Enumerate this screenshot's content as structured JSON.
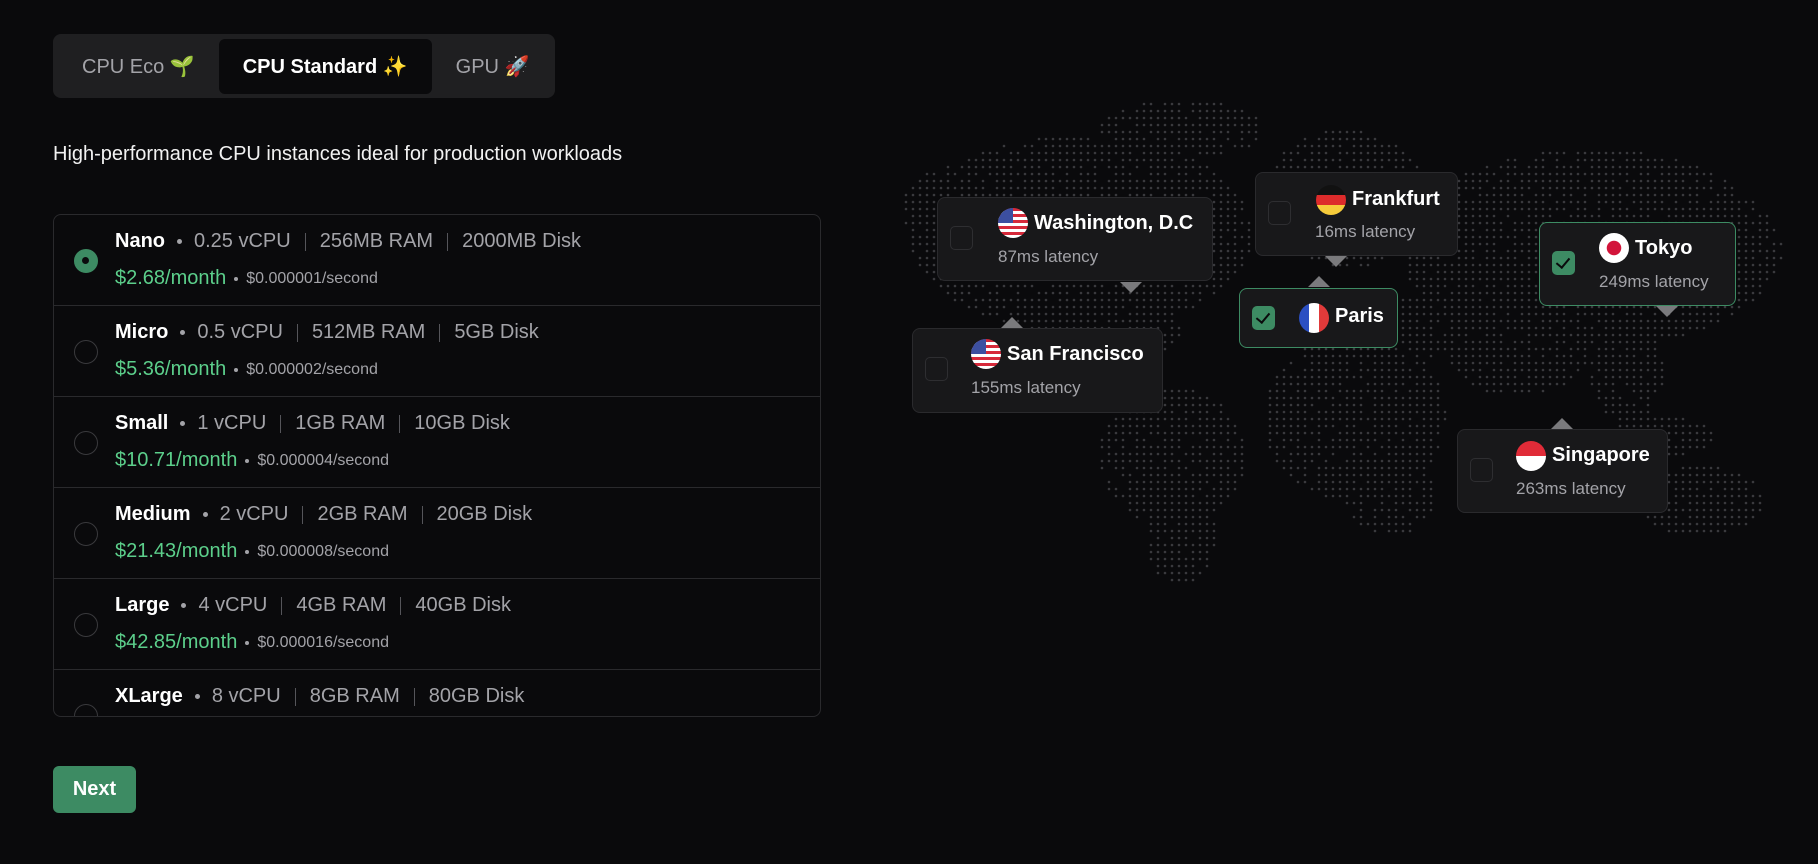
{
  "tabs": [
    {
      "label": "CPU Eco 🌱",
      "active": false
    },
    {
      "label": "CPU Standard ✨",
      "active": true
    },
    {
      "label": "GPU 🚀",
      "active": false
    }
  ],
  "description": "High-performance CPU instances ideal for production workloads",
  "plans": [
    {
      "name": "Nano",
      "cpu": "0.25 vCPU",
      "ram": "256MB RAM",
      "disk": "2000MB Disk",
      "price": "$2.68/month",
      "per_second": "$0.000001/second",
      "selected": true
    },
    {
      "name": "Micro",
      "cpu": "0.5 vCPU",
      "ram": "512MB RAM",
      "disk": "5GB Disk",
      "price": "$5.36/month",
      "per_second": "$0.000002/second",
      "selected": false
    },
    {
      "name": "Small",
      "cpu": "1 vCPU",
      "ram": "1GB RAM",
      "disk": "10GB Disk",
      "price": "$10.71/month",
      "per_second": "$0.000004/second",
      "selected": false
    },
    {
      "name": "Medium",
      "cpu": "2 vCPU",
      "ram": "2GB RAM",
      "disk": "20GB Disk",
      "price": "$21.43/month",
      "per_second": "$0.000008/second",
      "selected": false
    },
    {
      "name": "Large",
      "cpu": "4 vCPU",
      "ram": "4GB RAM",
      "disk": "40GB Disk",
      "price": "$42.85/month",
      "per_second": "$0.000016/second",
      "selected": false
    },
    {
      "name": "XLarge",
      "cpu": "8 vCPU",
      "ram": "8GB RAM",
      "disk": "80GB Disk",
      "selected": false
    }
  ],
  "next_label": "Next",
  "regions": [
    {
      "city": "Washington, D.C",
      "latency": "87ms latency",
      "flag": "us-flag-icon",
      "checked": false
    },
    {
      "city": "San Francisco",
      "latency": "155ms latency",
      "flag": "us-flag-icon",
      "checked": false
    },
    {
      "city": "Frankfurt",
      "latency": "16ms latency",
      "flag": "germany-flag-icon",
      "checked": false
    },
    {
      "city": "Paris",
      "flag": "france-flag-icon",
      "checked": true
    },
    {
      "city": "Tokyo",
      "latency": "249ms latency",
      "flag": "japan-flag-icon",
      "checked": true
    },
    {
      "city": "Singapore",
      "latency": "263ms latency",
      "flag": "singapore-flag-icon",
      "checked": false
    }
  ],
  "colors": {
    "accent": "#3d8b63",
    "price": "#5ccf8b",
    "background": "#0a0a0c",
    "card": "#18181a"
  }
}
